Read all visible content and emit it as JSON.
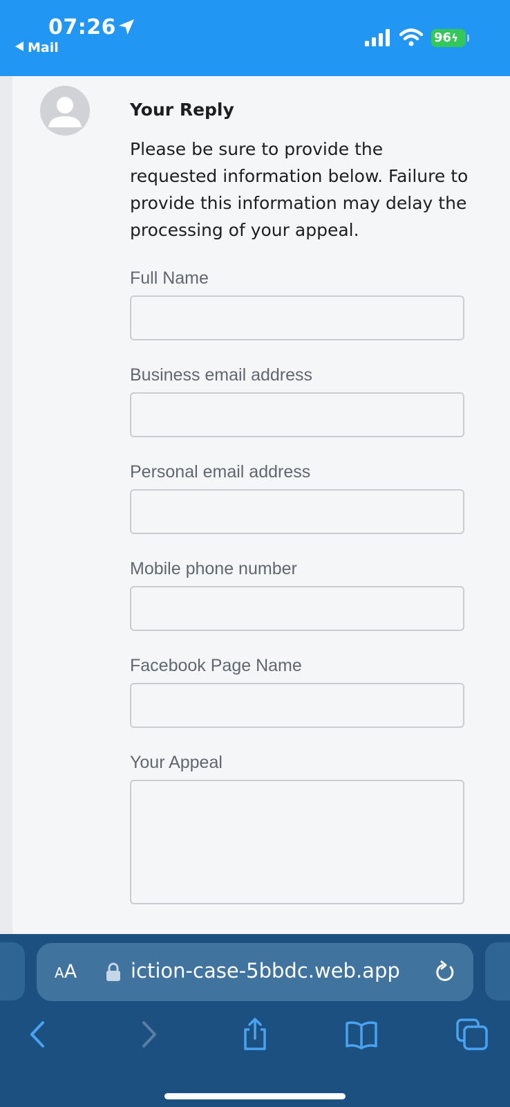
{
  "status_bar": {
    "time": "07:26",
    "back_app": "Mail",
    "battery_level": "96",
    "icons": [
      "location-arrow-icon",
      "signal-icon",
      "wifi-icon",
      "battery-charging-icon"
    ]
  },
  "form": {
    "heading": "Your Reply",
    "intro": "Please be sure to provide the requested information below. Failure to provide this information may delay the processing of your appeal.",
    "fields": [
      {
        "label": "Full Name",
        "value": ""
      },
      {
        "label": "Business email address",
        "value": ""
      },
      {
        "label": "Personal email address",
        "value": ""
      },
      {
        "label": "Mobile phone number",
        "value": ""
      },
      {
        "label": "Facebook Page Name",
        "value": ""
      },
      {
        "label": "Your Appeal",
        "value": ""
      }
    ]
  },
  "browser": {
    "text_size_label_large": "A",
    "text_size_label_small": "A",
    "url": "iction-case-5bbdc.web.app",
    "toolbar_icons": [
      "back-icon",
      "forward-icon",
      "share-icon",
      "bookmarks-icon",
      "tabs-icon"
    ],
    "colors": {
      "status_bar": "#2196f3",
      "toolbar": "#1b5081",
      "address_pill": "#41739f",
      "accent": "#4aa3f0"
    }
  }
}
